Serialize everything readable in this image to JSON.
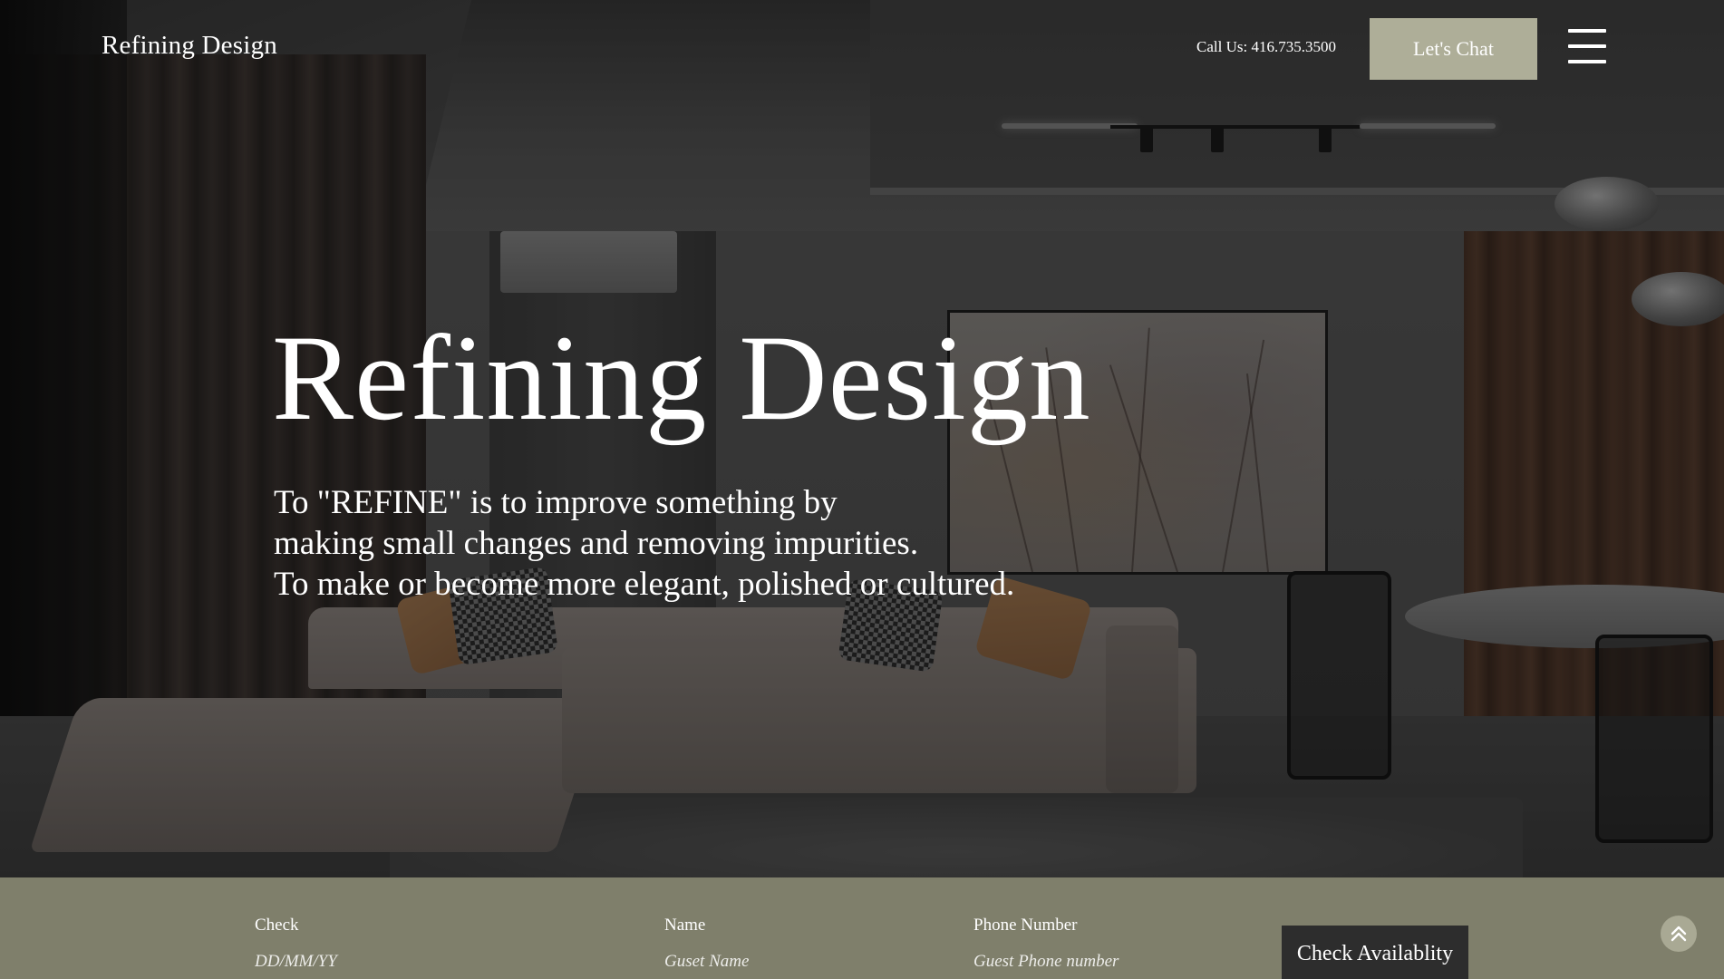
{
  "header": {
    "logo": "Refining Design",
    "call_us": "Call Us: 416.735.3500",
    "chat_button": "Let's Chat",
    "menu_icon": "hamburger-menu-icon"
  },
  "hero": {
    "title": "Refining Design",
    "description_lines": [
      "To \"REFINE\" is to improve something by",
      "making small changes and removing impurities.",
      "To make or become more elegant, polished or cultured."
    ]
  },
  "booking": {
    "fields": [
      {
        "label": "Check",
        "placeholder": "DD/MM/YY"
      },
      {
        "label": "Name",
        "placeholder": "Guset Name"
      },
      {
        "label": "Phone Number",
        "placeholder": "Guest Phone number"
      }
    ],
    "submit_label": "Check Availablity",
    "scroll_top_icon": "chevron-double-up-icon"
  },
  "colors": {
    "accent_button": "#aeae98",
    "booking_bar": "#7f7f6b",
    "dark_button": "#2d2d2d"
  }
}
